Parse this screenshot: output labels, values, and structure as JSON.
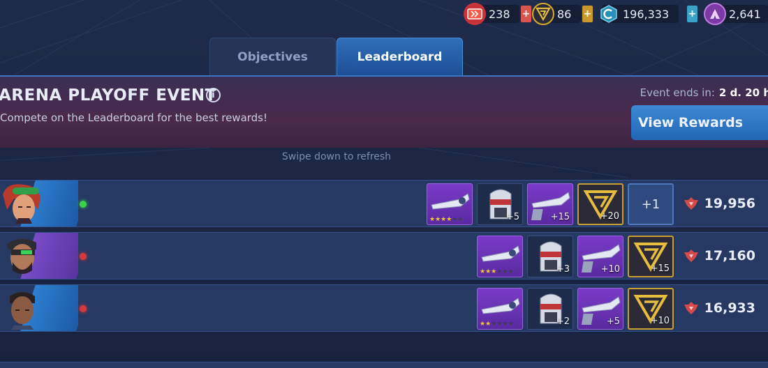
{
  "currencies": [
    {
      "id": "tickets",
      "value": "238",
      "color": "#d33a3a",
      "plus_color": "#d9534f"
    },
    {
      "id": "tokens",
      "value": "86",
      "color": "#d8ac2a",
      "plus_color": "#c99a2b"
    },
    {
      "id": "credits",
      "value": "196,333",
      "color": "#4cb8d4",
      "plus_color": "#3aa3c6"
    },
    {
      "id": "alliance",
      "value": "2,641",
      "color": "#a054c8"
    }
  ],
  "tabs": {
    "objectives": "Objectives",
    "leaderboard": "Leaderboard",
    "active": "leaderboard"
  },
  "event": {
    "title": "ARENA PLAYOFF EVENT",
    "subtitle": "Compete on the Leaderboard for the best rewards!",
    "ends_label": "Event ends in:",
    "ends_value": "2 d. 20 h",
    "view_rewards": "View Rewards"
  },
  "refresh_hint": "Swipe down to refresh",
  "rows": [
    {
      "status": "online",
      "status_color": "#3bd24a",
      "score": "19,956",
      "rewards": {
        "stars": 4,
        "gear_amt": "+5",
        "blade_amt": "+15",
        "token_amt": "+20",
        "extra": "+1"
      }
    },
    {
      "status": "offline",
      "status_color": "#d23b3b",
      "score": "17,160",
      "rewards": {
        "stars": 3,
        "gear_amt": "+3",
        "blade_amt": "+10",
        "token_amt": "+15"
      }
    },
    {
      "status": "offline",
      "status_color": "#d23b3b",
      "score": "16,933",
      "rewards": {
        "stars": 2,
        "gear_amt": "+2",
        "blade_amt": "+5",
        "token_amt": "+10"
      }
    }
  ]
}
